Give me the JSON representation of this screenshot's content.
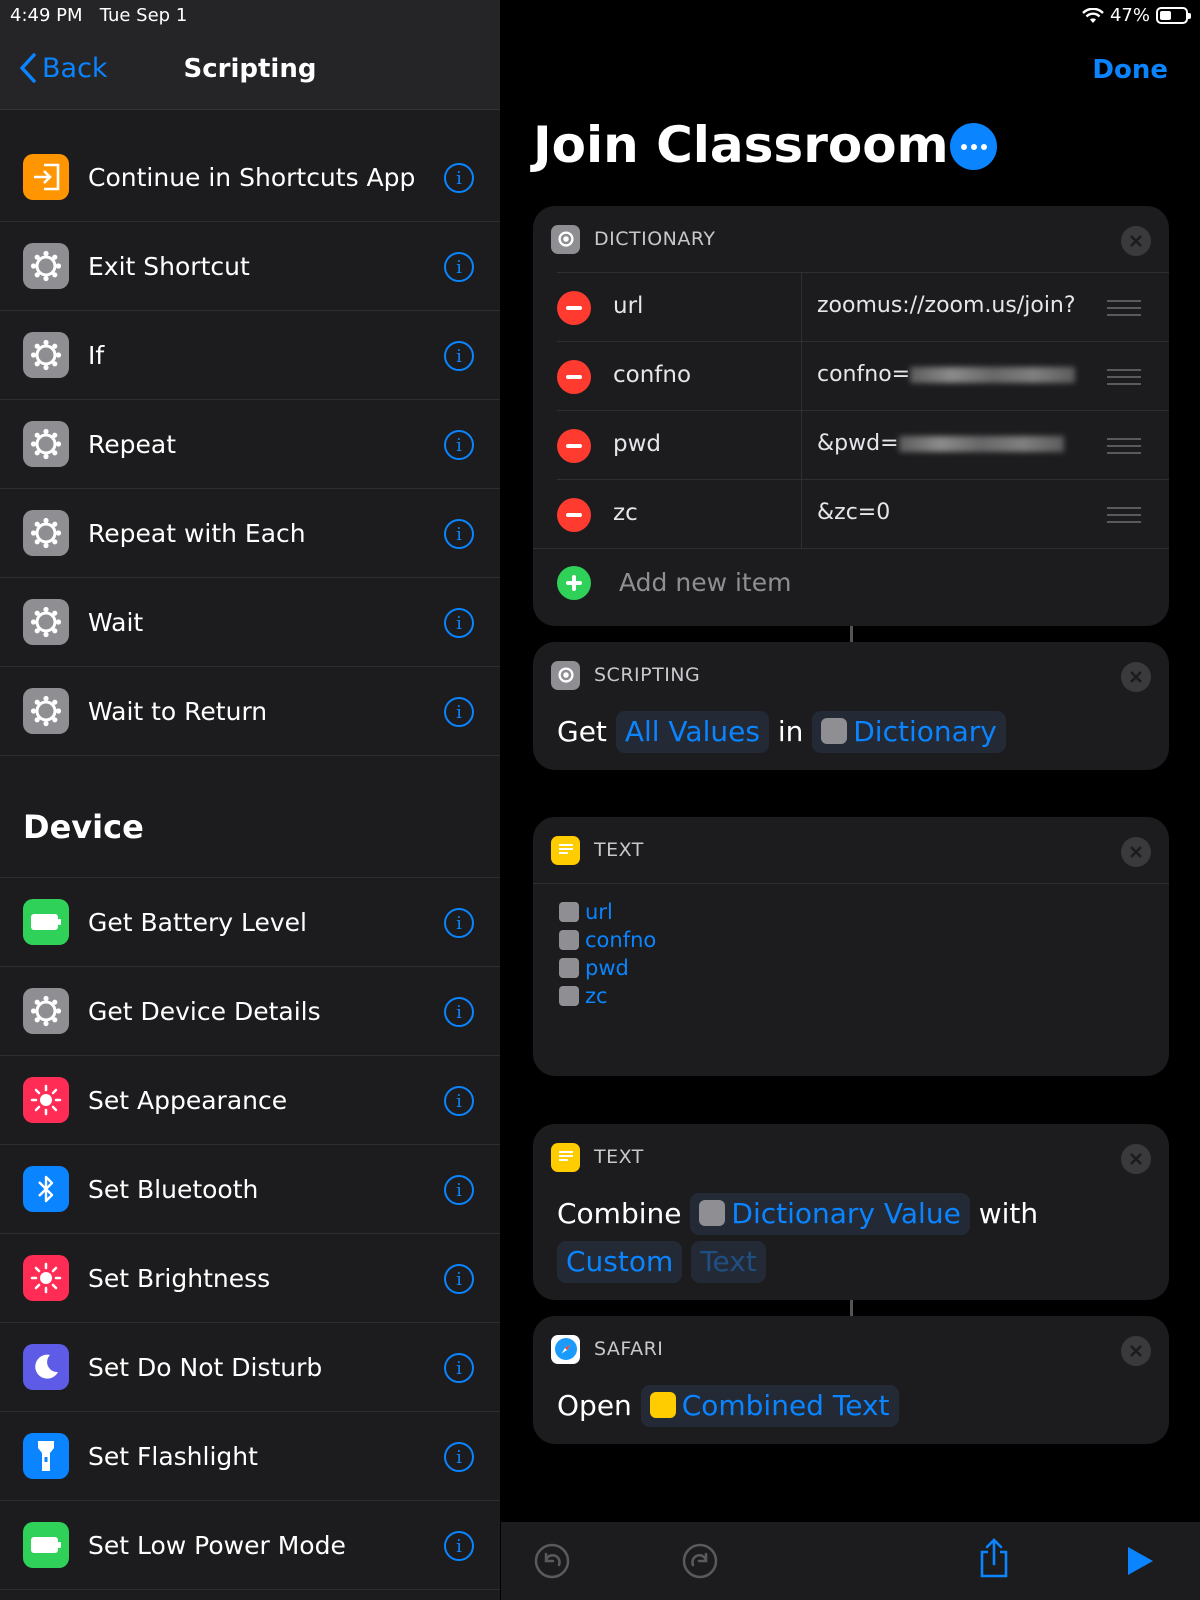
{
  "status": {
    "time": "4:49 PM",
    "date": "Tue Sep 1",
    "battery": "47%",
    "battery_level": 0.47
  },
  "left": {
    "back_label": "Back",
    "title": "Scripting",
    "items_top": [
      {
        "label": "Continue in Shortcuts App",
        "icon": "arrow-in-icon",
        "color": "#ff9500"
      },
      {
        "label": "Exit Shortcut",
        "icon": "gear-icon",
        "color": "#8e8e93"
      },
      {
        "label": "If",
        "icon": "gear-icon",
        "color": "#8e8e93"
      },
      {
        "label": "Repeat",
        "icon": "gear-icon",
        "color": "#8e8e93"
      },
      {
        "label": "Repeat with Each",
        "icon": "gear-icon",
        "color": "#8e8e93"
      },
      {
        "label": "Wait",
        "icon": "gear-icon",
        "color": "#8e8e93"
      },
      {
        "label": "Wait to Return",
        "icon": "gear-icon",
        "color": "#8e8e93"
      }
    ],
    "section_title": "Device",
    "items_device": [
      {
        "label": "Get Battery Level",
        "icon": "battery-icon",
        "color": "#30d158"
      },
      {
        "label": "Get Device Details",
        "icon": "gear-icon",
        "color": "#8e8e93"
      },
      {
        "label": "Set Appearance",
        "icon": "sun-icon",
        "color": "#ff2d55"
      },
      {
        "label": "Set Bluetooth",
        "icon": "bluetooth-icon",
        "color": "#0a84ff"
      },
      {
        "label": "Set Brightness",
        "icon": "sun-icon",
        "color": "#ff2d55"
      },
      {
        "label": "Set Do Not Disturb",
        "icon": "moon-icon",
        "color": "#5e5ce6"
      },
      {
        "label": "Set Flashlight",
        "icon": "flashlight-icon",
        "color": "#0a84ff"
      },
      {
        "label": "Set Low Power Mode",
        "icon": "battery-icon",
        "color": "#30d158"
      }
    ]
  },
  "right": {
    "done_label": "Done",
    "title": "Join Classroom",
    "dictionary": {
      "header": "DICTIONARY",
      "rows": [
        {
          "key": "url",
          "value": "zoomus://zoom.us/join?"
        },
        {
          "key": "confno",
          "value": "confno="
        },
        {
          "key": "pwd",
          "value": "&pwd="
        },
        {
          "key": "zc",
          "value": "&zc=0"
        }
      ],
      "add_label": "Add new item"
    },
    "get_values": {
      "header": "SCRIPTING",
      "w1": "Get",
      "token1": "All Values",
      "w2": "in",
      "token2": "Dictionary"
    },
    "text_block": {
      "header": "TEXT",
      "lines": [
        "url",
        "confno",
        "pwd",
        "zc"
      ]
    },
    "combine": {
      "header": "TEXT",
      "w1": "Combine",
      "token1": "Dictionary Value",
      "w2": "with",
      "token2": "Custom",
      "token3": "Text"
    },
    "safari": {
      "header": "SAFARI",
      "w1": "Open",
      "token1": "Combined Text"
    }
  }
}
